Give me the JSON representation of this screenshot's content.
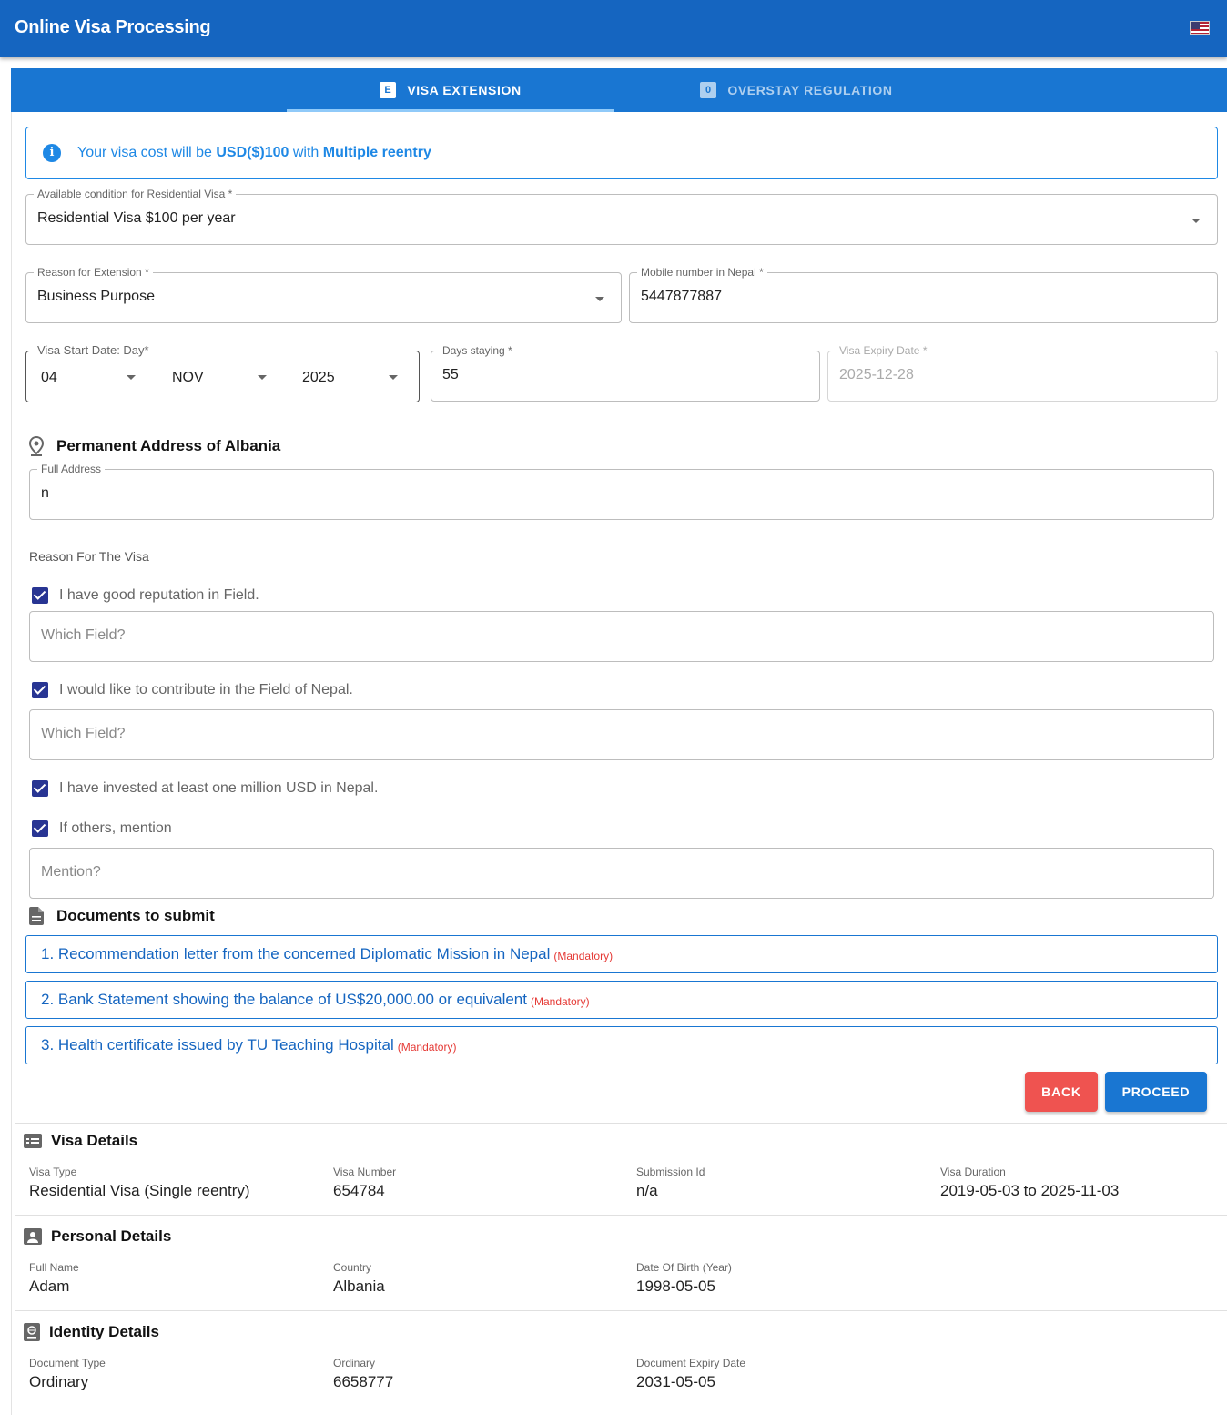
{
  "app": {
    "title": "Online Visa Processing",
    "language_flag": "us-flag-icon"
  },
  "tabs": [
    {
      "badge": "E",
      "label": "VISA EXTENSION",
      "active": true
    },
    {
      "badge": "0",
      "label": "OVERSTAY REGULATION",
      "active": false
    }
  ],
  "alert": {
    "prefix": "Your visa cost will be ",
    "cost": "USD($)100",
    "mid": " with ",
    "reentry": "Multiple reentry"
  },
  "form": {
    "condition": {
      "label": "Available condition for Residential Visa *",
      "value": "Residential Visa $100 per year"
    },
    "reason": {
      "label": "Reason for Extension *",
      "value": "Business Purpose"
    },
    "mobile": {
      "label": "Mobile number in Nepal *",
      "value": "5447877887"
    },
    "start_date": {
      "label": "Visa Start Date: Day*",
      "day": "04",
      "month": "NOV",
      "year": "2025"
    },
    "days_staying": {
      "label": "Days staying *",
      "value": "55"
    },
    "expiry": {
      "label": "Visa Expiry Date *",
      "value": "2025-12-28"
    },
    "address_section": "Permanent Address of Albania",
    "full_address": {
      "label": "Full Address",
      "value": "n"
    },
    "reason_visa_label": "Reason For The Visa",
    "checks": [
      {
        "label": "I have good reputation in Field.",
        "checked": true
      },
      {
        "label": "I would like to contribute in the Field of Nepal.",
        "checked": true
      },
      {
        "label": "I have invested at least one million USD in Nepal.",
        "checked": true
      },
      {
        "label": "If others, mention",
        "checked": true
      }
    ],
    "which_field_1": "Which Field?",
    "which_field_2": "Which Field?",
    "mention": "Mention?"
  },
  "documents": {
    "title": "Documents to submit",
    "items": [
      {
        "text": "1. Recommendation letter from the concerned Diplomatic Mission in Nepal",
        "tag": "(Mandatory)"
      },
      {
        "text": "2. Bank Statement showing the balance of US$20,000.00 or equivalent",
        "tag": "(Mandatory)"
      },
      {
        "text": "3. Health certificate issued by TU Teaching Hospital",
        "tag": "(Mandatory)"
      }
    ]
  },
  "buttons": {
    "back": "BACK",
    "proceed": "PROCEED"
  },
  "visa_details": {
    "title": "Visa Details",
    "fields": [
      {
        "k": "Visa Type",
        "v": "Residential Visa (Single reentry)"
      },
      {
        "k": "Visa Number",
        "v": "654784"
      },
      {
        "k": "Submission Id",
        "v": "n/a"
      },
      {
        "k": "Visa Duration",
        "v": "2019-05-03 to 2025-11-03"
      }
    ]
  },
  "personal_details": {
    "title": "Personal Details",
    "fields": [
      {
        "k": "Full Name",
        "v": "Adam"
      },
      {
        "k": "Country",
        "v": "Albania"
      },
      {
        "k": "Date Of Birth (Year)",
        "v": "1998-05-05"
      }
    ]
  },
  "identity_details": {
    "title": "Identity Details",
    "fields": [
      {
        "k": "Document Type",
        "v": "Ordinary"
      },
      {
        "k": "Ordinary",
        "v": "6658777"
      },
      {
        "k": "Document Expiry Date",
        "v": "2031-05-05"
      }
    ]
  }
}
